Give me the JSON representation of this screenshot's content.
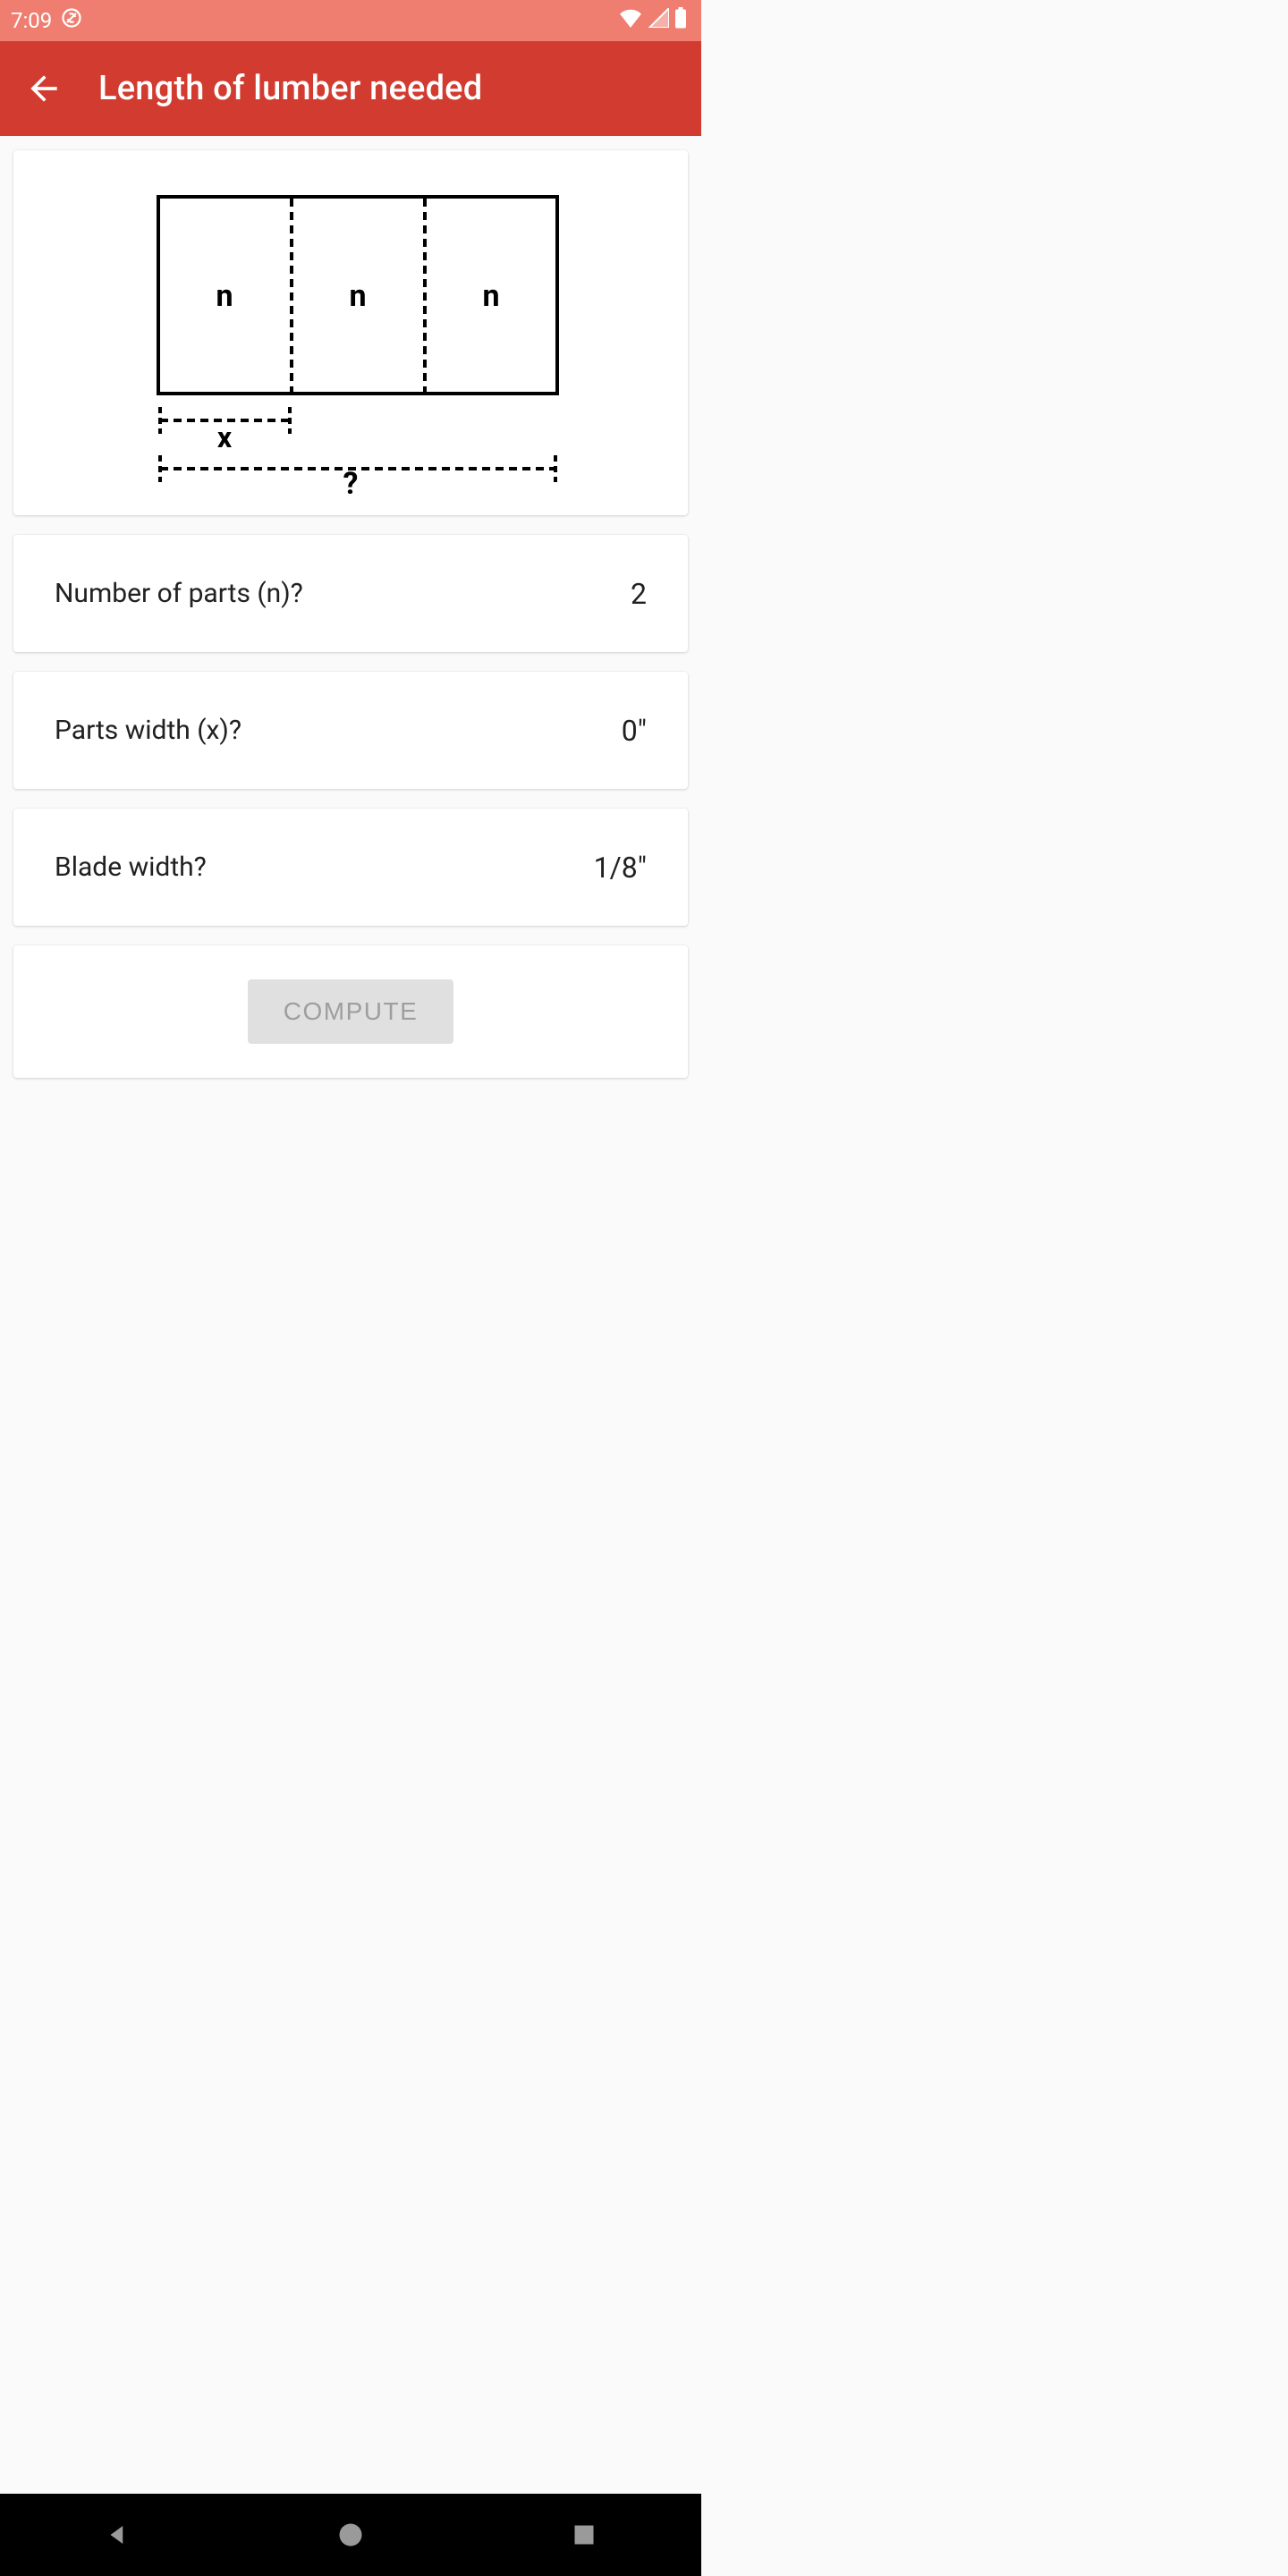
{
  "status": {
    "time": "7:09"
  },
  "header": {
    "title": "Length of lumber needed"
  },
  "diagram": {
    "part_label_1": "n",
    "part_label_2": "n",
    "part_label_3": "n",
    "width_label": "x",
    "total_label": "?"
  },
  "inputs": {
    "num_parts": {
      "label": "Number of parts (n)?",
      "value": "2"
    },
    "parts_width": {
      "label": "Parts width (x)?",
      "value": "0\""
    },
    "blade_width": {
      "label": "Blade width?",
      "value": "1/8\""
    }
  },
  "compute_label": "COMPUTE"
}
